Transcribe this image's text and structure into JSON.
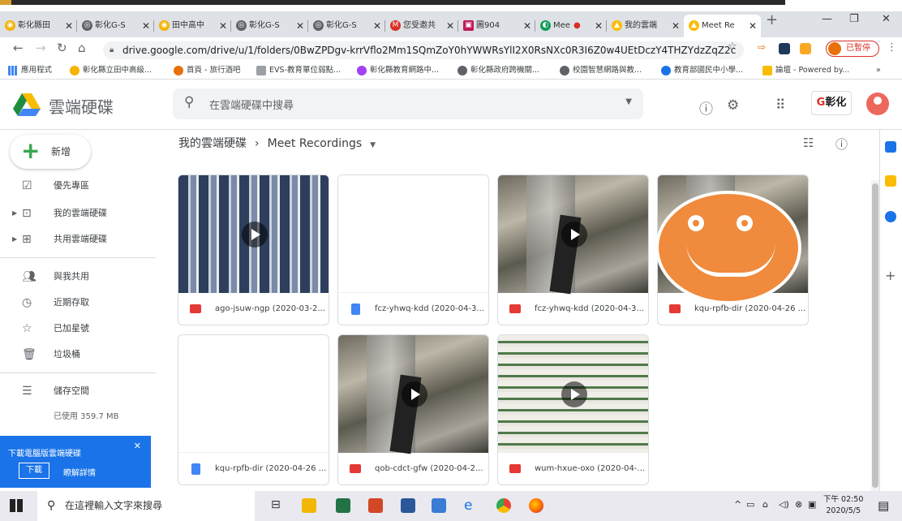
{
  "browser": {
    "tabs": [
      {
        "label": "彰化縣田"
      },
      {
        "label": "彰化G-S"
      },
      {
        "label": "田中高中"
      },
      {
        "label": "彰化G-S"
      },
      {
        "label": "彰化G-S"
      },
      {
        "label": "您受邀共"
      },
      {
        "label": "圖904"
      },
      {
        "label": "Mee"
      },
      {
        "label": "我的雲端"
      },
      {
        "label": "Meet Re"
      }
    ],
    "url": "drive.google.com/drive/u/1/folders/0BwZPDgv-krrVflo2Mm1SQmZoY0hYWWRsYlI2X0RsNXc0R3I6Z0w4UEtDczY4THZYdzZqZ2c",
    "paused_label": "已暫停",
    "bookmarks": [
      {
        "label": "應用程式",
        "color": "#4285f4"
      },
      {
        "label": "彰化縣立田中高級...",
        "color": "#f4b400"
      },
      {
        "label": "首頁 - 旅行酒吧",
        "color": "#e8710a"
      },
      {
        "label": "EVS-教育單位弱點...",
        "color": "#9aa0a6"
      },
      {
        "label": "彰化縣教育網路中...",
        "color": "#a142f4"
      },
      {
        "label": "彰化縣政府跨機關...",
        "color": "#5f6368"
      },
      {
        "label": "校園智慧網路與教...",
        "color": "#5f6368"
      },
      {
        "label": "教育部國民中小學...",
        "color": "#1a73e8"
      },
      {
        "label": "論壇 - Powered by...",
        "color": "#fbbc04"
      }
    ]
  },
  "drive": {
    "brand": "雲端硬碟",
    "search_placeholder": "在雲端硬碟中搜尋",
    "gsuite_label": "彰化",
    "new_button": "新增",
    "nav": [
      {
        "label": "優先專區",
        "icon": "priority-icon"
      },
      {
        "label": "我的雲端硬碟",
        "icon": "my-drive-icon"
      },
      {
        "label": "共用雲端硬碟",
        "icon": "shared-drives-icon"
      },
      {
        "label": "與我共用",
        "icon": "shared-with-me-icon"
      },
      {
        "label": "近期存取",
        "icon": "recent-icon"
      },
      {
        "label": "已加星號",
        "icon": "star-icon"
      },
      {
        "label": "垃圾桶",
        "icon": "trash-icon"
      },
      {
        "label": "儲存空間",
        "icon": "storage-icon"
      }
    ],
    "storage_used": "已使用 359.7 MB",
    "promo": {
      "title": "下載電腦版雲端硬碟",
      "download": "下載",
      "learn_more": "瞭解詳情"
    },
    "breadcrumb": {
      "root": "我的雲端硬碟",
      "current": "Meet Recordings"
    },
    "files": [
      {
        "name": "ago-jsuw-ngp (2020-03-2...",
        "type": "video"
      },
      {
        "name": "fcz-yhwq-kdd (2020-04-3...",
        "type": "doc"
      },
      {
        "name": "fcz-yhwq-kdd (2020-04-3...",
        "type": "video"
      },
      {
        "name": "kqu-rpfb-dir (2020-04-26 ...",
        "type": "video"
      },
      {
        "name": "kqu-rpfb-dir (2020-04-26 ...",
        "type": "doc"
      },
      {
        "name": "qob-cdct-gfw (2020-04-2...",
        "type": "video"
      },
      {
        "name": "wum-hxue-oxo (2020-04-...",
        "type": "video"
      }
    ]
  },
  "taskbar": {
    "search_placeholder": "在這裡輸入文字來搜尋",
    "time": "下午 02:50",
    "date": "2020/5/5"
  }
}
